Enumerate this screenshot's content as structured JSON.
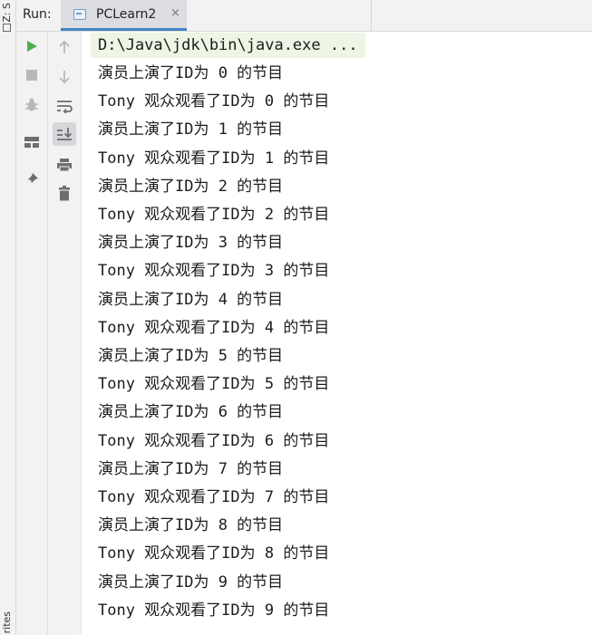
{
  "side_strip": {
    "top_text": "Z: S",
    "bottom_text": "rites"
  },
  "header": {
    "run_label": "Run:",
    "tab": {
      "title": "PCLearn2",
      "close": "×"
    }
  },
  "toolbar": {
    "primary": [
      {
        "name": "run-icon",
        "color": "#4caf50"
      },
      {
        "name": "stop-icon",
        "color": "#b8b8b8"
      },
      {
        "name": "debug-bug-icon",
        "color": "#b8b8b8"
      },
      {
        "name": "layout-icon",
        "color": "#6e6e6e"
      },
      {
        "name": "pin-icon",
        "color": "#6e6e6e"
      }
    ],
    "secondary": [
      {
        "name": "arrow-up-icon",
        "color": "#b8b8b8"
      },
      {
        "name": "arrow-down-icon",
        "color": "#b8b8b8"
      },
      {
        "name": "soft-wrap-icon",
        "color": "#6e6e6e"
      },
      {
        "name": "scroll-to-end-icon",
        "color": "#6e6e6e"
      },
      {
        "name": "print-icon",
        "color": "#6e6e6e"
      },
      {
        "name": "trash-icon",
        "color": "#6e6e6e"
      }
    ]
  },
  "console": {
    "command_line": "D:\\Java\\jdk\\bin\\java.exe ...",
    "lines": [
      "演员上演了ID为 0 的节目",
      "Tony 观众观看了ID为 0 的节目",
      "演员上演了ID为 1 的节目",
      "Tony 观众观看了ID为 1 的节目",
      "演员上演了ID为 2 的节目",
      "Tony 观众观看了ID为 2 的节目",
      "演员上演了ID为 3 的节目",
      "Tony 观众观看了ID为 3 的节目",
      "演员上演了ID为 4 的节目",
      "Tony 观众观看了ID为 4 的节目",
      "演员上演了ID为 5 的节目",
      "Tony 观众观看了ID为 5 的节目",
      "演员上演了ID为 6 的节目",
      "Tony 观众观看了ID为 6 的节目",
      "演员上演了ID为 7 的节目",
      "Tony 观众观看了ID为 7 的节目",
      "演员上演了ID为 8 的节目",
      "Tony 观众观看了ID为 8 的节目",
      "演员上演了ID为 9 的节目",
      "Tony 观众观看了ID为 9 的节目"
    ]
  }
}
